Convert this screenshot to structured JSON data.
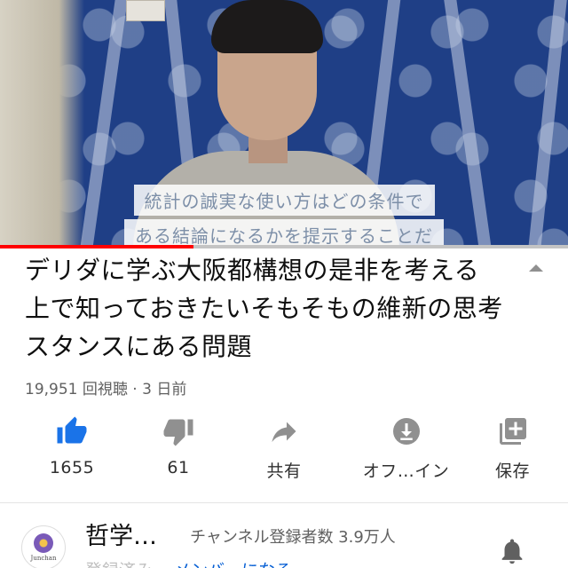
{
  "video": {
    "captions": [
      "統計の誠実な使い方はどの条件で",
      "ある結論になるかを提示することだ"
    ],
    "progress_fraction": 0.34
  },
  "details": {
    "title": "デリダに学ぶ大阪都構想の是非を考える上で知っておきたいそもそもの維新の思考スタンスにある問題",
    "meta": "19,951 回視聴 · 3 日前"
  },
  "actions": [
    {
      "icon": "thumb-up-icon",
      "label": "1655"
    },
    {
      "icon": "thumb-down-icon",
      "label": "61"
    },
    {
      "icon": "share-icon",
      "label": "共有"
    },
    {
      "icon": "download-icon",
      "label": "オフ…イン"
    },
    {
      "icon": "add-to-playlist-icon",
      "label": "保存"
    }
  ],
  "channel": {
    "avatar_text": "Junchan",
    "name": "哲学…",
    "subscribers": "チャンネル登録者数 3.9万人",
    "partial_left": "登録済み",
    "partial_right": "メンバーになる"
  },
  "colors": {
    "like_active": "#1a73e8",
    "icon_gray": "#909090",
    "progress": "#ff0000"
  }
}
